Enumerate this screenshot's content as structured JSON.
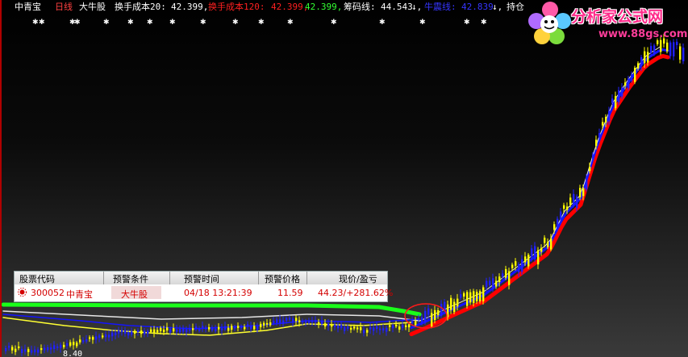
{
  "topbar": {
    "stock_name": "中青宝",
    "period": "日线",
    "signal_name": "大牛股",
    "cost20_label": "换手成本20:",
    "cost20_value": "42.399,",
    "cost120_label": "换手成本120:",
    "cost120_value1": "42.399,",
    "cost120_value2": "42.399,",
    "chip_label": "筹码线:",
    "chip_value": "44.543",
    "chip_arrow": "↓,",
    "mid_label": "牛震线:",
    "mid_value": "42.839",
    "mid_arrow": "↓,",
    "hold_label": "持仓"
  },
  "logo": {
    "title": "分析家公式网",
    "url": "www.88gs.com"
  },
  "alert_table": {
    "columns": [
      "股票代码",
      "预警条件",
      "预警时间",
      "预警价格",
      "现价/盈亏"
    ],
    "row": {
      "code": "300052",
      "name": "中青宝",
      "condition": "大牛股",
      "time": "04/18 13:21:39",
      "price": "11.59",
      "current": "44.23/+281.62%"
    }
  },
  "chart_labels": {
    "low_price": "8.40"
  },
  "colors": {
    "up_candle": "#ffff00",
    "down_candle": "#2020ff",
    "cost_line_red": "#ff0000",
    "cost_line_blue": "#1414ff",
    "green_band": "#19ff19",
    "white_line": "#e6e6e6",
    "yellow_line": "#ffff33"
  }
}
